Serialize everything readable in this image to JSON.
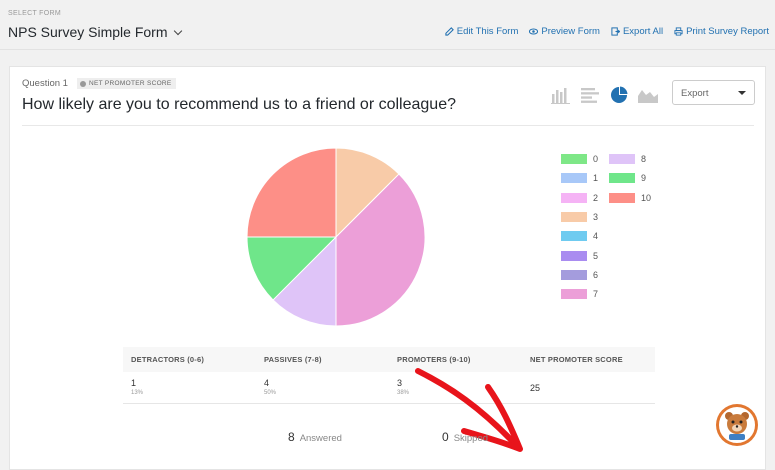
{
  "header": {
    "select_label": "SELECT FORM",
    "form_title": "NPS Survey Simple Form",
    "actions": [
      "Edit This Form",
      "Preview Form",
      "Export All",
      "Print Survey Report"
    ]
  },
  "question": {
    "number": "Question 1",
    "badge": "NET PROMOTER SCORE",
    "title": "How likely are you to recommend us to a friend or colleague?"
  },
  "export": {
    "label": "Export"
  },
  "chart_data": {
    "type": "pie",
    "categories": [
      "0",
      "1",
      "2",
      "3",
      "4",
      "5",
      "6",
      "7",
      "8",
      "9",
      "10"
    ],
    "values": [
      0,
      0,
      0,
      1,
      0,
      0,
      0,
      3,
      1,
      1,
      2
    ],
    "colors": [
      "#7ee787",
      "#a8c8f8",
      "#f5b3f5",
      "#f8cba8",
      "#6fcbf0",
      "#a98cf0",
      "#a49cdd",
      "#ec9fd8",
      "#dfc4f8",
      "#6fe68a",
      "#fd8f87"
    ]
  },
  "nps": {
    "headers": [
      "DETRACTORS (0-6)",
      "PASSIVES (7-8)",
      "PROMOTERS (9-10)",
      "NET PROMOTER SCORE"
    ],
    "detractors": {
      "count": "1",
      "pct": "13%"
    },
    "passives": {
      "count": "4",
      "pct": "50%"
    },
    "promoters": {
      "count": "3",
      "pct": "38%"
    },
    "score": "25"
  },
  "stats": {
    "answered_count": "8",
    "answered_label": "Answered",
    "skipped_count": "0",
    "skipped_label": "Skipped"
  }
}
